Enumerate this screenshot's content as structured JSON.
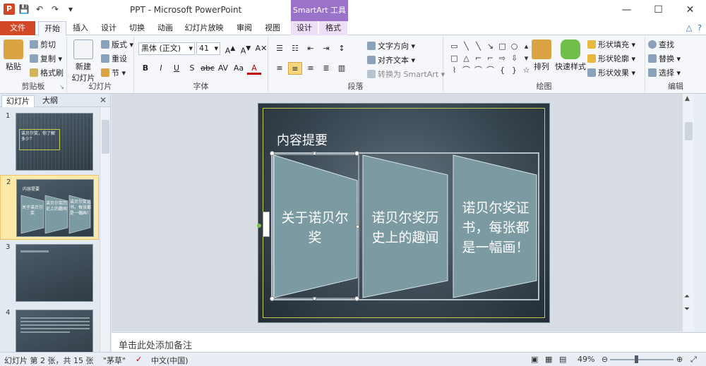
{
  "title_bar": {
    "app_icon": "P",
    "qat_icons": [
      "save-icon",
      "undo-icon",
      "redo-icon",
      "customize-icon"
    ],
    "title": "PPT - Microsoft PowerPoint",
    "contextual_tools": "SmartArt 工具",
    "window_controls": [
      "—",
      "☐",
      "✕"
    ]
  },
  "tabs": [
    "文件",
    "开始",
    "插入",
    "设计",
    "切换",
    "动画",
    "幻灯片放映",
    "审阅",
    "视图",
    "设计",
    "格式"
  ],
  "ribbon": {
    "clipboard": {
      "paste": "粘贴",
      "cut": "剪切",
      "copy": "复制",
      "format_painter": "格式刷",
      "label": "剪贴板"
    },
    "slides": {
      "new_slide": "新建",
      "new_slide_2": "幻灯片",
      "layout": "版式",
      "reset": "重设",
      "section": "节",
      "label": "幻灯片"
    },
    "font": {
      "font_name": "黑体 (正文)",
      "font_size": "41",
      "label": "字体"
    },
    "paragraph": {
      "text_direction": "文字方向",
      "align_text": "对齐文本",
      "convert_smartart": "转换为 SmartArt",
      "label": "段落"
    },
    "drawing": {
      "arrange": "排列",
      "quick_styles": "快速样式",
      "shape_fill": "形状填充",
      "shape_outline": "形状轮廓",
      "shape_effects": "形状效果",
      "label": "绘图"
    },
    "editing": {
      "find": "查找",
      "replace": "替换",
      "select": "选择",
      "label": "编辑"
    }
  },
  "left_panel": {
    "tab_slides": "幻灯片",
    "tab_outline": "大纲",
    "close": "✕",
    "slides": [
      {
        "num": "1"
      },
      {
        "num": "2"
      },
      {
        "num": "3"
      },
      {
        "num": "4"
      }
    ],
    "thumb1_title": "诺贝尔奖，你了解多少？",
    "thumb2_title": "内容提要",
    "thumb2_items": [
      "关于诺贝尔奖",
      "诺贝尔奖历史上的趣闻",
      "诺贝尔奖证书，每张都是一幅画！"
    ]
  },
  "slide": {
    "title": "内容提要",
    "items": [
      "关于诺贝尔奖",
      "诺贝尔奖历史上的趣闻",
      "诺贝尔奖证书，每张都是一幅画！"
    ],
    "colors": {
      "trap_fill": "#7b9aa2",
      "trap_stroke": "#d7e4e8"
    }
  },
  "notes": {
    "placeholder": "单击此处添加备注"
  },
  "status_bar": {
    "slide_info": "幻灯片 第 2 张，共 15 张",
    "theme": "\"茅草\"",
    "language": "中文(中国)",
    "zoom": "49%"
  }
}
